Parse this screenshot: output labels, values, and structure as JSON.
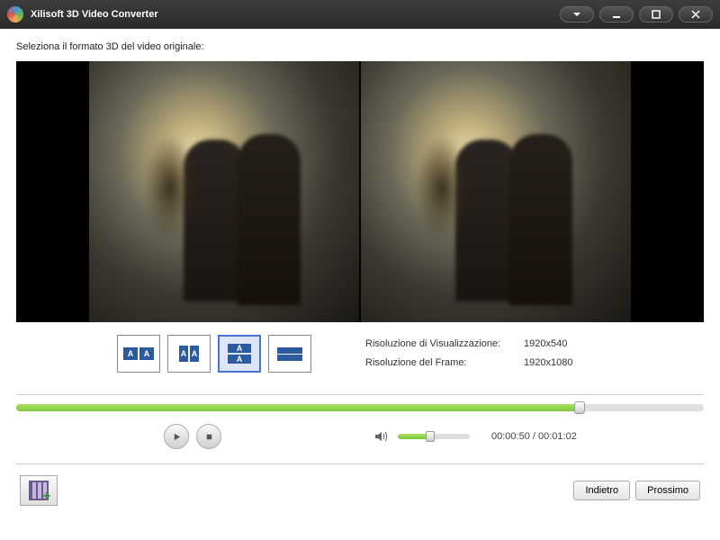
{
  "app": {
    "title": "Xilisoft 3D Video Converter"
  },
  "instruction": "Seleziona il formato 3D del video originale:",
  "formats": {
    "selected_index": 2
  },
  "info": {
    "display_res_label": "Risoluzione di Visualizzazione:",
    "display_res_value": "1920x540",
    "frame_res_label": "Risoluzione del Frame:",
    "frame_res_value": "1920x1080"
  },
  "playback": {
    "progress_pct": 82,
    "volume_pct": 45,
    "current_time": "00:00:50",
    "total_time": "00:01:02"
  },
  "nav": {
    "back": "Indietro",
    "next": "Prossimo"
  }
}
